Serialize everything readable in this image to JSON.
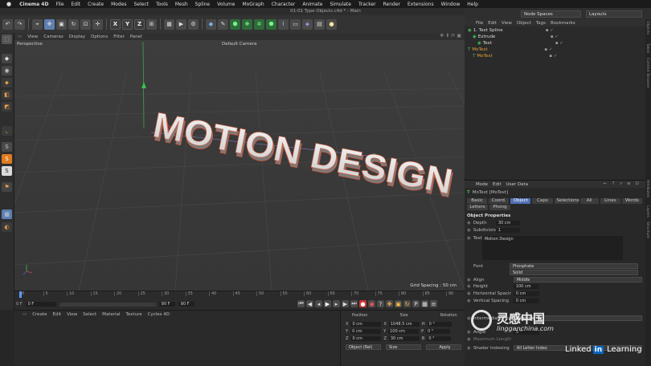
{
  "mac_menu": [
    "Cinema 4D",
    "File",
    "Edit",
    "Create",
    "Modes",
    "Select",
    "Tools",
    "Mesh",
    "Spline",
    "Volume",
    "MoGraph",
    "Character",
    "Animate",
    "Simulate",
    "Tracker",
    "Render",
    "Extensions",
    "Window",
    "Help"
  ],
  "window_title": "01-01 Type Objects.c4d * - Main",
  "layout": {
    "node_spaces": "Node Spaces",
    "layouts": "Layouts"
  },
  "viewport_menu": [
    "View",
    "Cameras",
    "Display",
    "Options",
    "Filter",
    "Panel"
  ],
  "viewport": {
    "name": "Perspective",
    "camera": "Default Camera",
    "grid_spacing": "Grid Spacing : 50 cm",
    "text_3d": "MOTION DESIGN"
  },
  "timeline": {
    "ticks": [
      "0",
      "5",
      "10",
      "15",
      "20",
      "25",
      "30",
      "35",
      "40",
      "45",
      "50",
      "55",
      "60",
      "65",
      "70",
      "75",
      "80",
      "85",
      "90"
    ],
    "frame_start": "0 F",
    "frame_current": "0 F",
    "frame_end_a": "90 F",
    "frame_end_b": "90 F",
    "frame_label": "0 F"
  },
  "material_menu": [
    "Create",
    "Edit",
    "View",
    "Select",
    "Material",
    "Texture",
    "Cycles 4D"
  ],
  "coords": {
    "headers": [
      "Position",
      "Size",
      "Rotation"
    ],
    "rows": [
      {
        "axis": "X",
        "pos": "0 cm",
        "size_axis": "X",
        "size": "1048.5 cm",
        "rot_axis": "H",
        "rot": "0 °"
      },
      {
        "axis": "Y",
        "pos": "0 cm",
        "size_axis": "Y",
        "size": "100 cm",
        "rot_axis": "P",
        "rot": "0 °"
      },
      {
        "axis": "Z",
        "pos": "0 cm",
        "size_axis": "Z",
        "size": "30 cm",
        "rot_axis": "B",
        "rot": "0 °"
      }
    ],
    "mode": "Object (Rel)",
    "size_mode": "Size",
    "apply": "Apply"
  },
  "object_manager": {
    "menu": [
      "File",
      "Edit",
      "View",
      "Object",
      "Tags",
      "Bookmarks"
    ],
    "objects": [
      {
        "name": "1. Text Spline",
        "indent": 0,
        "color": "#dddddd"
      },
      {
        "name": "Extrude",
        "indent": 1,
        "color": "#dddddd"
      },
      {
        "name": "Text",
        "indent": 2,
        "color": "#dddddd"
      },
      {
        "name": "MoText",
        "indent": 0,
        "color": "#e0a03a"
      },
      {
        "name": "MoText",
        "indent": 1,
        "color": "#e0a03a"
      }
    ]
  },
  "attributes": {
    "menu": [
      "Mode",
      "Edit",
      "User Data"
    ],
    "object": "MoText [MoText]",
    "tabs_row1": [
      "Basic",
      "Coord.",
      "Object",
      "Caps",
      "Selections",
      "All",
      "Lines",
      "Words"
    ],
    "tabs_row2": [
      "Letters",
      "Phong"
    ],
    "section": "Object Properties",
    "depth_label": "Depth",
    "depth": "30 cm",
    "subdiv_label": "Subdivision",
    "subdiv": "1",
    "text_label": "Text",
    "text": "Motion Design",
    "font_label": "Font",
    "font": "Phosphate",
    "font_style": "Solid",
    "align_label": "Align",
    "align": "Middle",
    "height_label": "Height",
    "height": "100 cm",
    "hspace_label": "Horizontal Spacing",
    "hspace": "0 cm",
    "vspace_label": "Vertical Spacing",
    "vspace": "0 cm",
    "points_label": "Intermediate Points",
    "points": "Adaptive",
    "angle_label": "Angle",
    "angle": "5 °",
    "max_label": "Maximum Length",
    "shader_label": "Shader Indexing",
    "shader": "All Letter Index"
  },
  "side_tabs": [
    "Objects",
    "Takes",
    "Content Browser",
    "Attributes",
    "Layers",
    "Structure"
  ],
  "watermark": {
    "cn": "灵感中国",
    "url": "lingganchina.com"
  },
  "branding": {
    "linked": "Linked",
    "in": "in",
    "learning": "Learning"
  }
}
